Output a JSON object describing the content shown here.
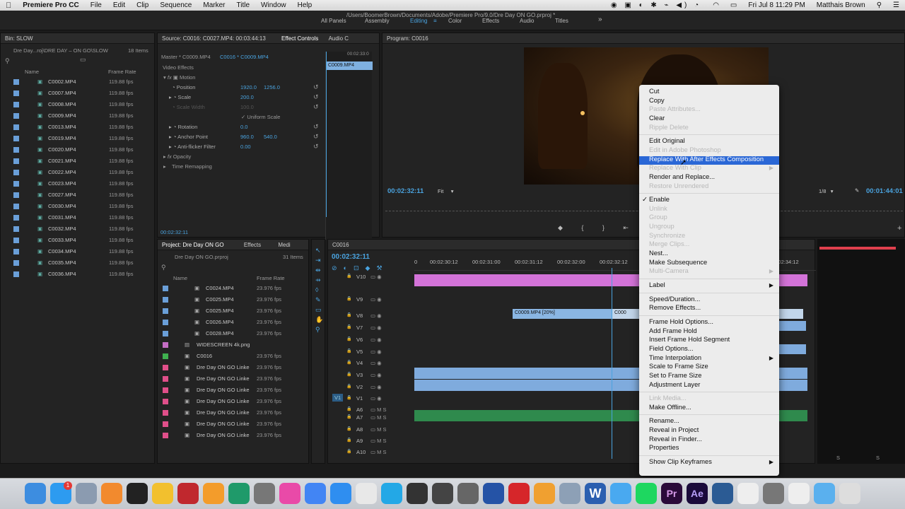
{
  "menubar": {
    "app": "Premiere Pro CC",
    "items": [
      "File",
      "Edit",
      "Clip",
      "Sequence",
      "Marker",
      "Title",
      "Window",
      "Help"
    ],
    "clock": "Fri Jul 8  11:29 PM",
    "user": "Matthais Brown",
    "battery": "100%"
  },
  "workspace": {
    "path": "/Users/BoomerBrown/Documents/Adobe/Premiere Pro/9.0/Dre Day ON GO.prproj *",
    "tabs": [
      "All Panels",
      "Assembly",
      "Editing",
      "Color",
      "Effects",
      "Audio",
      "Titles"
    ],
    "more": "»"
  },
  "bin": {
    "title": "Bin: SLOW",
    "path": "Dre Day...roj\\DRE DAY – ON GO\\SLOW",
    "count": "18 Items",
    "col_name": "Name",
    "col_rate": "Frame Rate",
    "items": [
      [
        "C0002.MP4",
        "119.88 fps"
      ],
      [
        "C0007.MP4",
        "119.88 fps"
      ],
      [
        "C0008.MP4",
        "119.88 fps"
      ],
      [
        "C0009.MP4",
        "119.88 fps"
      ],
      [
        "C0013.MP4",
        "119.88 fps"
      ],
      [
        "C0019.MP4",
        "119.88 fps"
      ],
      [
        "C0020.MP4",
        "119.88 fps"
      ],
      [
        "C0021.MP4",
        "119.88 fps"
      ],
      [
        "C0022.MP4",
        "119.88 fps"
      ],
      [
        "C0023.MP4",
        "119.88 fps"
      ],
      [
        "C0027.MP4",
        "119.88 fps"
      ],
      [
        "C0030.MP4",
        "119.88 fps"
      ],
      [
        "C0031.MP4",
        "119.88 fps"
      ],
      [
        "C0032.MP4",
        "119.88 fps"
      ],
      [
        "C0033.MP4",
        "119.88 fps"
      ],
      [
        "C0034.MP4",
        "119.88 fps"
      ],
      [
        "C0035.MP4",
        "119.88 fps"
      ],
      [
        "C0036.MP4",
        "119.88 fps"
      ]
    ]
  },
  "effects": {
    "source_tab": "Source: C0016: C0027.MP4: 00:03:44:13",
    "tab": "Effect Controls",
    "audio_tab": "Audio C",
    "master": "Master * C0009.MP4",
    "seq": "C0016 * C0009.MP4",
    "mini_clip": "C0009.MP4",
    "mini_time": "00:02:33:0",
    "section": "Video Effects",
    "motion": "Motion",
    "props": [
      [
        "Position",
        "1920.0",
        "1256.0"
      ],
      [
        "Scale",
        "200.0",
        ""
      ],
      [
        "Scale Width",
        "100.0",
        ""
      ],
      [
        "",
        "",
        ""
      ],
      [
        "Rotation",
        "0.0",
        ""
      ],
      [
        "Anchor Point",
        "960.0",
        "540.0"
      ],
      [
        "Anti-flicker Filter",
        "0.00",
        ""
      ]
    ],
    "uniform": "✓ Uniform Scale",
    "opacity": "Opacity",
    "time_remap": "Time Remapping",
    "timecode": "00:02:32:11"
  },
  "program": {
    "title": "Program: C0016",
    "timecode": "00:02:32:11",
    "fit": "Fit",
    "quality": "1/8",
    "duration": "00:01:44:01"
  },
  "project": {
    "title": "Project: Dre Day ON GO",
    "tab2": "Effects",
    "tab3": "Medi",
    "file": "Dre Day ON GO.prproj",
    "count": "31 Items",
    "col_name": "Name",
    "col_rate": "Frame Rate",
    "items": [
      [
        "C0024.MP4",
        "23.976 fps",
        "#6a9fd8"
      ],
      [
        "C0025.MP4",
        "23.976 fps",
        "#6a9fd8"
      ],
      [
        "C0025.MP4",
        "23.976 fps",
        "#6a9fd8"
      ],
      [
        "C0026.MP4",
        "23.976 fps",
        "#6a9fd8"
      ],
      [
        "C0028.MP4",
        "23.976 fps",
        "#6a9fd8"
      ],
      [
        "WIDESCREEN 4k.png",
        "",
        "#c56ec5"
      ],
      [
        "C0016",
        "23.976 fps",
        "#3fb04f"
      ],
      [
        "Dre Day ON GO Linke",
        "23.976 fps",
        "#e04f8a"
      ],
      [
        "Dre Day ON GO Linke",
        "23.976 fps",
        "#e04f8a"
      ],
      [
        "Dre Day ON GO Linke",
        "23.976 fps",
        "#e04f8a"
      ],
      [
        "Dre Day ON GO Linke",
        "23.976 fps",
        "#e04f8a"
      ],
      [
        "Dre Day ON GO Linke",
        "23.976 fps",
        "#e04f8a"
      ],
      [
        "Dre Day ON GO Linke",
        "23.976 fps",
        "#e04f8a"
      ],
      [
        "Dre Day ON GO Linke",
        "23.976 fps",
        "#e04f8a"
      ]
    ]
  },
  "timeline": {
    "title": "C0016",
    "timecode": "00:02:32:11",
    "ruler": [
      "0",
      "00:02:30:12",
      "00:02:31:00",
      "00:02:31:12",
      "00:02:32:00",
      "00:02:32:12",
      "00:02:34:12"
    ],
    "tracks": [
      "V10",
      "V9",
      "V8",
      "V7",
      "V6",
      "V5",
      "V4",
      "V3",
      "V2",
      "V1",
      "A6",
      "A7",
      "A8",
      "A9",
      "A10"
    ],
    "src_v1": "V1",
    "clip1": "C0009.MP4 [20%]",
    "clip2": "C000"
  },
  "context_menu": [
    {
      "label": "Cut"
    },
    {
      "label": "Copy"
    },
    {
      "label": "Paste Attributes...",
      "disabled": true
    },
    {
      "label": "Clear"
    },
    {
      "label": "Ripple Delete",
      "disabled": true
    },
    {
      "sep": true
    },
    {
      "label": "Edit Original"
    },
    {
      "label": "Edit in Adobe Photoshop",
      "disabled": true
    },
    {
      "label": "Replace With After Effects Composition",
      "selected": true
    },
    {
      "label": "Replace With Clip",
      "disabled": true,
      "sub": true
    },
    {
      "label": "Render and Replace..."
    },
    {
      "label": "Restore Unrendered",
      "disabled": true
    },
    {
      "sep": true
    },
    {
      "label": "Enable",
      "checked": true
    },
    {
      "label": "Unlink",
      "disabled": true
    },
    {
      "label": "Group",
      "disabled": true
    },
    {
      "label": "Ungroup",
      "disabled": true
    },
    {
      "label": "Synchronize",
      "disabled": true
    },
    {
      "label": "Merge Clips...",
      "disabled": true
    },
    {
      "label": "Nest..."
    },
    {
      "label": "Make Subsequence"
    },
    {
      "label": "Multi-Camera",
      "disabled": true,
      "sub": true
    },
    {
      "sep": true
    },
    {
      "label": "Label",
      "sub": true
    },
    {
      "sep": true
    },
    {
      "label": "Speed/Duration..."
    },
    {
      "label": "Remove Effects..."
    },
    {
      "sep": true
    },
    {
      "label": "Frame Hold Options..."
    },
    {
      "label": "Add Frame Hold"
    },
    {
      "label": "Insert Frame Hold Segment"
    },
    {
      "label": "Field Options..."
    },
    {
      "label": "Time Interpolation",
      "sub": true
    },
    {
      "label": "Scale to Frame Size"
    },
    {
      "label": "Set to Frame Size"
    },
    {
      "label": "Adjustment Layer"
    },
    {
      "sep": true
    },
    {
      "label": "Link Media...",
      "disabled": true
    },
    {
      "label": "Make Offline..."
    },
    {
      "sep": true
    },
    {
      "label": "Rename..."
    },
    {
      "label": "Reveal in Project"
    },
    {
      "label": "Reveal in Finder..."
    },
    {
      "label": "Properties"
    },
    {
      "sep": true
    },
    {
      "label": "Show Clip Keyframes",
      "sub": true
    }
  ],
  "meter": {
    "labels": [
      "S",
      "S"
    ]
  },
  "dock": {
    "badge": "1",
    "apps": [
      "finder",
      "app-store",
      "preview",
      "launchpad",
      "dashboard",
      "photos",
      "photo-booth",
      "ibooks",
      "time-machine",
      "system-preferences",
      "itunes",
      "chrome",
      "safari",
      "text-edit",
      "skype",
      "claquette",
      "final-cut",
      "aperture",
      "stage",
      "creative-cloud",
      "spark",
      "mail",
      "word",
      "messages",
      "spotify",
      "premiere",
      "after-effects",
      "quicktime",
      "help",
      "photo",
      "help2",
      "folder",
      "trash"
    ],
    "premiere": "Pr",
    "aftereffects": "Ae",
    "word": "W"
  }
}
